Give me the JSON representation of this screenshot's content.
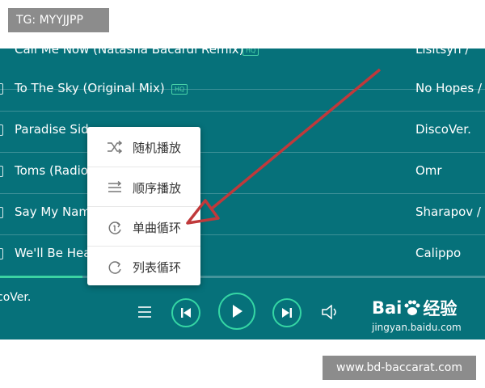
{
  "badge_top": "TG: MYYJJPP",
  "badge_bottom": "www.bd-baccarat.com",
  "playlist": {
    "rows": [
      {
        "title": "Call Me Now (Natasha Bacardi Remix)",
        "artist": "Lisitsyn /",
        "hq": "HQ"
      },
      {
        "title": "To The Sky (Original Mix)",
        "artist": "No Hopes /",
        "hq": "HQ"
      },
      {
        "title": "Paradise Sid",
        "artist": "DiscoVer.",
        "hq": ""
      },
      {
        "title": "Toms (Radio",
        "artist": "Omr",
        "hq": ""
      },
      {
        "title": "Say My Nam",
        "artist": "Sharapov /",
        "hq": ""
      },
      {
        "title": "We'll Be Hea",
        "artist": "Calippo",
        "hq": ""
      }
    ]
  },
  "now_playing": {
    "artist": "coVer.",
    "progress": 0.17
  },
  "play_mode_menu": {
    "items": [
      {
        "label": "随机播放",
        "icon": "shuffle-icon"
      },
      {
        "label": "顺序播放",
        "icon": "sequential-icon"
      },
      {
        "label": "单曲循环",
        "icon": "repeat-one-icon"
      },
      {
        "label": "列表循环",
        "icon": "repeat-list-icon"
      }
    ]
  },
  "watermark": {
    "brand_left": "Bai",
    "brand_right": "经验",
    "url": "jingyan.baidu.com"
  },
  "colors": {
    "player_bg": "#06717a",
    "accent": "#35d6a4",
    "arrow": "#c0393b"
  }
}
